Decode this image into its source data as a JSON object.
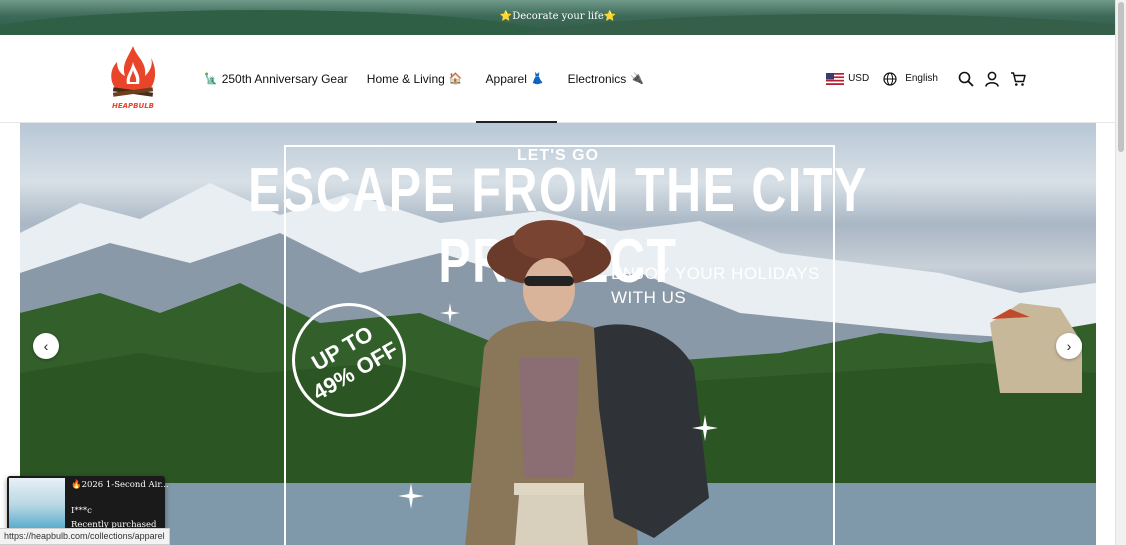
{
  "announcement": {
    "text": "⭐Decorate your life⭐"
  },
  "brand": {
    "logo_text": "HEAPBULB"
  },
  "nav": {
    "items": [
      {
        "label": "250th Anniversary Gear",
        "emoji": "🗽"
      },
      {
        "label": "Home & Living",
        "emoji": "🏠"
      },
      {
        "label": "Apparel",
        "emoji": "👗"
      },
      {
        "label": "Electronics",
        "emoji": "🔌"
      }
    ]
  },
  "tools": {
    "currency": "USD",
    "language": "English",
    "icons": [
      "globe-icon",
      "search-icon",
      "account-icon",
      "cart-icon"
    ]
  },
  "hero": {
    "lets_go": "LET'S GO",
    "headline": "ESCAPE FROM THE CITY PROJECT",
    "enjoy_line1": "ENJOY YOUR HOLIDAYS",
    "enjoy_line2": "WITH US",
    "offer_line1": "UP TO",
    "offer_line2": "49% OFF",
    "prev_arrow": "‹",
    "next_arrow": "›"
  },
  "popup": {
    "title": "🔥2026 1-Second Air...",
    "name": "I***c",
    "subtitle": "Recently purchased"
  },
  "status_bar": {
    "url": "https://heapbulb.com/collections/apparel"
  },
  "colors": {
    "accent": "#e8452a",
    "header_border": "#e6e6e6"
  }
}
